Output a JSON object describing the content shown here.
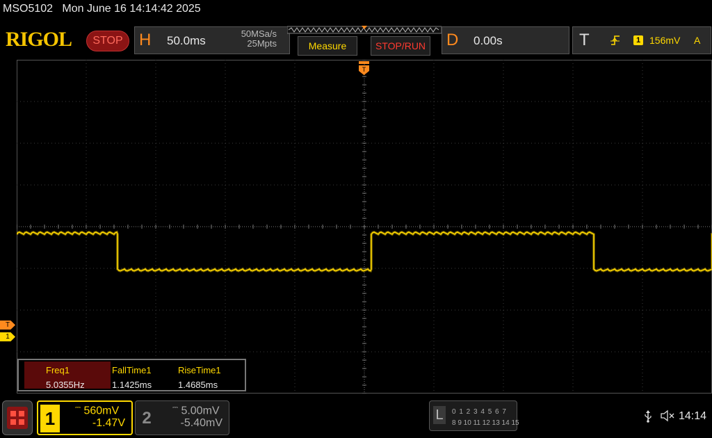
{
  "status_bar": {
    "model": "MSO5102",
    "datetime": "Mon June 16 14:14:42 2025"
  },
  "header": {
    "logo": "RIGOL",
    "run_state": "STOP",
    "horizontal": {
      "letter": "H",
      "timebase": "50.0ms",
      "sample_rate": "50MSa/s",
      "memory_depth": "25Mpts"
    },
    "measure_label": "Measure",
    "stop_run_label": "STOP/RUN",
    "delay": {
      "letter": "D",
      "value": "0.00s"
    },
    "trigger": {
      "letter": "T",
      "source": "1",
      "level": "156mV",
      "mode": "A"
    }
  },
  "markers": {
    "trigger_left": "T",
    "ch1_left": "1",
    "trigger_top": "T"
  },
  "measurements": {
    "headers": [
      "Freq1",
      "FallTime1",
      "RiseTime1"
    ],
    "values": [
      "5.0355Hz",
      "1.1425ms",
      "1.4685ms"
    ]
  },
  "channels": {
    "ch1": {
      "number": "1",
      "scale": "560mV",
      "offset": "-1.47V"
    },
    "ch2": {
      "number": "2",
      "scale": "5.00mV",
      "offset": "-5.40mV"
    }
  },
  "logic": {
    "letter": "L",
    "row1": "0 1 2 3   4 5 6 7",
    "row2": "8 9 10 11 12 13 14 15"
  },
  "system": {
    "time": "14:14"
  },
  "colors": {
    "ch1": "#ffd800",
    "accent_orange": "#ff8a1e",
    "stop_red": "#ff3a30"
  },
  "icons": [
    "usb-icon",
    "speaker-muted-icon",
    "menu-grid-icon",
    "trigger-rising-edge-icon"
  ],
  "waveform": {
    "channel": "1",
    "type": "square",
    "frequency_hz": 5.0355,
    "timebase_per_div_ms": 50,
    "high_level_div": 0.4,
    "low_level_div": -0.6,
    "transitions_div": [
      1.45,
      5.1,
      8.3,
      11.6
    ],
    "first_level": "high"
  }
}
